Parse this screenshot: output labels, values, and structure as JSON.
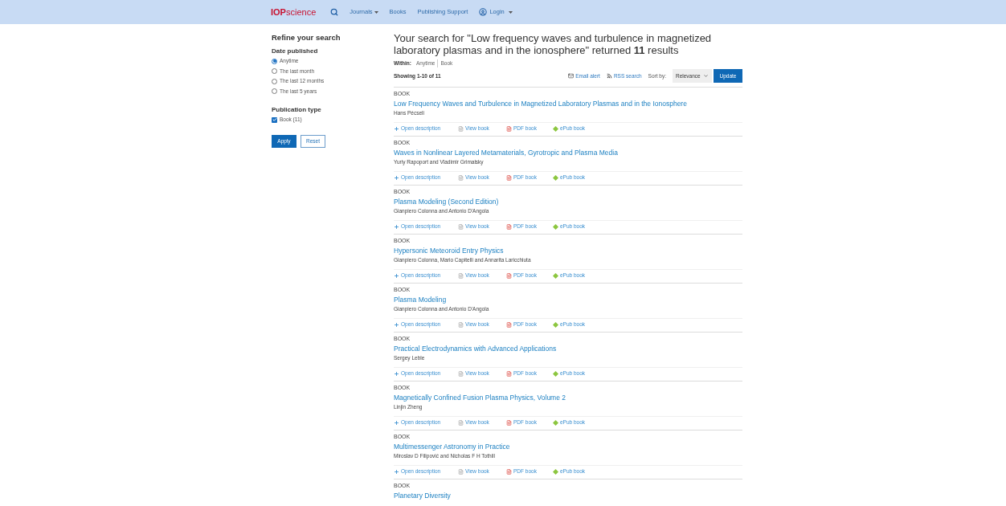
{
  "nav": {
    "logo_bold": "IOP",
    "logo_rest": "science",
    "items": [
      {
        "label": "Journals",
        "dropdown": true
      },
      {
        "label": "Books",
        "dropdown": false
      },
      {
        "label": "Publishing Support",
        "dropdown": false
      }
    ],
    "login": "Login"
  },
  "sidebar": {
    "title": "Refine your search",
    "date_heading": "Date published",
    "date_options": [
      {
        "label": "Anytime",
        "selected": true
      },
      {
        "label": "The last month",
        "selected": false
      },
      {
        "label": "The last 12 months",
        "selected": false
      },
      {
        "label": "The last 5 years",
        "selected": false
      }
    ],
    "type_heading": "Publication type",
    "type_options": [
      {
        "label": "Book (11)",
        "checked": true
      }
    ],
    "apply": "Apply",
    "reset": "Reset"
  },
  "results_heading": "Your search for \"Low frequency waves and turbulence in magnetized laboratory plasmas and in the ionosphere\" returned **11** results",
  "within": {
    "label": "Within:",
    "filters": [
      "Anytime",
      "Book"
    ]
  },
  "showing": "Showing 1-10 of 11",
  "toolbar": {
    "email_alert": "Email alert",
    "rss": "RSS search",
    "sort_label": "Sort by:",
    "sort_value": "Relevance",
    "update": "Update"
  },
  "results": [
    {
      "type": "BOOK",
      "title": "Low Frequency Waves and Turbulence in Magnetized Laboratory Plasmas and in the Ionosphere",
      "authors": "Hans Pécseli",
      "actions": {
        "open": "Open description",
        "view": "View book",
        "pdf": "PDF book",
        "epub": "ePub book"
      }
    },
    {
      "type": "BOOK",
      "title": "Waves in Nonlinear Layered Metamaterials, Gyrotropic and Plasma Media",
      "authors": "Yuriy Rapoport and Vladimir Grimalsky",
      "actions": {
        "open": "Open description",
        "view": "View book",
        "pdf": "PDF book",
        "epub": "ePub book"
      }
    },
    {
      "type": "BOOK",
      "title": "Plasma Modeling (Second Edition)",
      "authors": "Gianpiero Colonna and Antonio D'Angola",
      "actions": {
        "open": "Open description",
        "view": "View book",
        "pdf": "PDF book",
        "epub": "ePub book"
      }
    },
    {
      "type": "BOOK",
      "title": "Hypersonic Meteoroid Entry Physics",
      "authors": "Gianpiero Colonna, Mario Capitelli and Annarita Laricchiuta",
      "actions": {
        "open": "Open description",
        "view": "View book",
        "pdf": "PDF book",
        "epub": "ePub book"
      }
    },
    {
      "type": "BOOK",
      "title": "Plasma Modeling",
      "authors": "Gianpiero Colonna and Antonio D'Angola",
      "actions": {
        "open": "Open description",
        "view": "View book",
        "pdf": "PDF book",
        "epub": "ePub book"
      }
    },
    {
      "type": "BOOK",
      "title": "Practical Electrodynamics with Advanced Applications",
      "authors": "Sergey Leble",
      "actions": {
        "open": "Open description",
        "view": "View book",
        "pdf": "PDF book",
        "epub": "ePub book"
      }
    },
    {
      "type": "BOOK",
      "title": "Magnetically Confined Fusion Plasma Physics, Volume 2",
      "authors": "Linjin Zheng",
      "actions": {
        "open": "Open description",
        "view": "View book",
        "pdf": "PDF book",
        "epub": "ePub book"
      }
    },
    {
      "type": "BOOK",
      "title": "Multimessenger Astronomy in Practice",
      "authors": "Miroslav D Filipović and Nicholas F H Tothill",
      "actions": {
        "open": "Open description",
        "view": "View book",
        "pdf": "PDF book",
        "epub": "ePub book"
      }
    },
    {
      "type": "BOOK",
      "title": "Planetary Diversity"
    }
  ]
}
